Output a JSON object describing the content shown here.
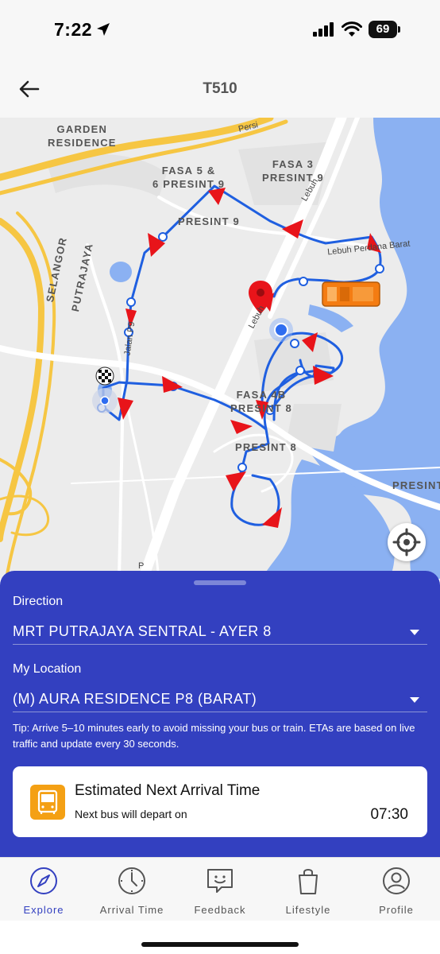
{
  "status_bar": {
    "time": "7:22",
    "battery": "69",
    "icons": [
      "location-arrow-icon",
      "signal-icon",
      "wifi-icon",
      "battery-icon"
    ]
  },
  "header": {
    "title": "T510",
    "back_icon": "back-arrow-icon"
  },
  "map": {
    "labels": {
      "garden_residence": "GARDEN\nRESIDENCE",
      "fasa5": "FASA 5 &\n6 PRESINT 9",
      "fasa3": "FASA 3\nPRESINT 9",
      "presint9": "PRESINT 9",
      "selangor": "SELANGOR",
      "putrajaya": "PUTRAJAYA",
      "fasa4b": "FASA 4B\nPRESINT 8",
      "presint8": "PRESINT 8",
      "presint_right": "PRESINT"
    },
    "road_labels": {
      "persiaran": "Persi",
      "lebuh_perdana": "Lebuh",
      "lebuh_perdana_barat": "Lebuh Perdana Barat",
      "lebuh_road": "Lebuh",
      "jalan": "Jalan P9",
      "p_left": "P"
    },
    "route_color": "#1f5fe0",
    "arrow_color": "#e8141a",
    "bus_color": "#f47c12",
    "locate_icon": "locate-crosshair-icon"
  },
  "panel": {
    "direction_label": "Direction",
    "direction_value": "MRT PUTRAJAYA SENTRAL - AYER 8",
    "location_label": "My Location",
    "location_value": "(M) AURA RESIDENCE P8 (BARAT)",
    "tip": "Tip: Arrive 5–10 minutes early to avoid missing your bus or train. ETAs are based on live traffic and update every 30 seconds.",
    "eta_title": "Estimated Next Arrival Time",
    "eta_subtitle": "Next bus will depart on",
    "eta_time": "07:30",
    "accent_color": "#3340c0"
  },
  "nav": {
    "items": [
      {
        "label": "Explore",
        "icon": "compass-icon",
        "active": true
      },
      {
        "label": "Arrival Time",
        "icon": "clock-icon",
        "active": false
      },
      {
        "label": "Feedback",
        "icon": "feedback-smile-icon",
        "active": false
      },
      {
        "label": "Lifestyle",
        "icon": "shopping-bag-icon",
        "active": false
      },
      {
        "label": "Profile",
        "icon": "profile-icon",
        "active": false
      }
    ]
  }
}
